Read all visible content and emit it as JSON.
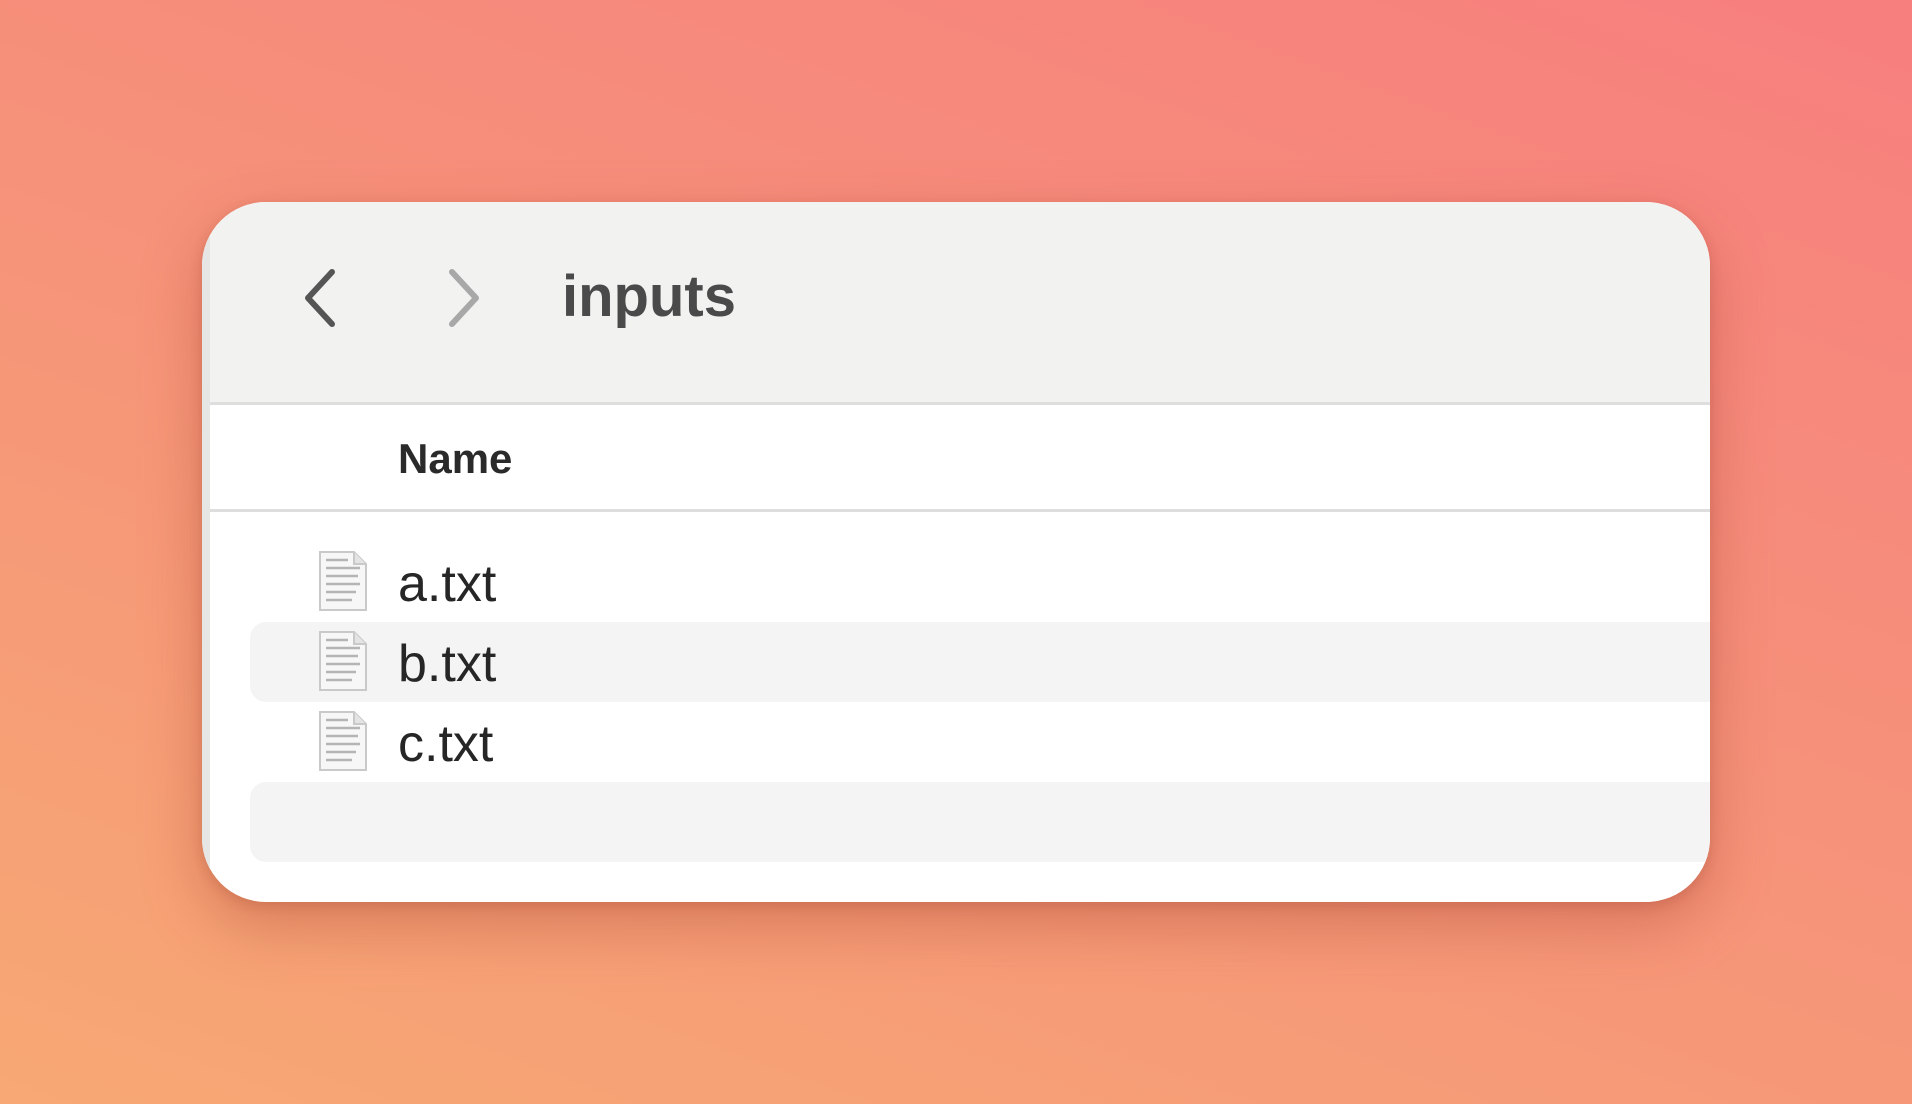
{
  "window": {
    "title": "inputs"
  },
  "toolbar": {
    "back_icon": "chevron-left-icon",
    "forward_icon": "chevron-right-icon"
  },
  "table": {
    "columns": [
      "Name"
    ],
    "rows": [
      {
        "name": "a.txt",
        "icon": "text-document-icon"
      },
      {
        "name": "b.txt",
        "icon": "text-document-icon"
      },
      {
        "name": "c.txt",
        "icon": "text-document-icon"
      }
    ]
  },
  "colors": {
    "background_start": "#f7a874",
    "background_end": "#f77f7e",
    "toolbar_bg": "#f2f2f0",
    "alt_row_bg": "#f3f4f3",
    "text": "#262626"
  }
}
